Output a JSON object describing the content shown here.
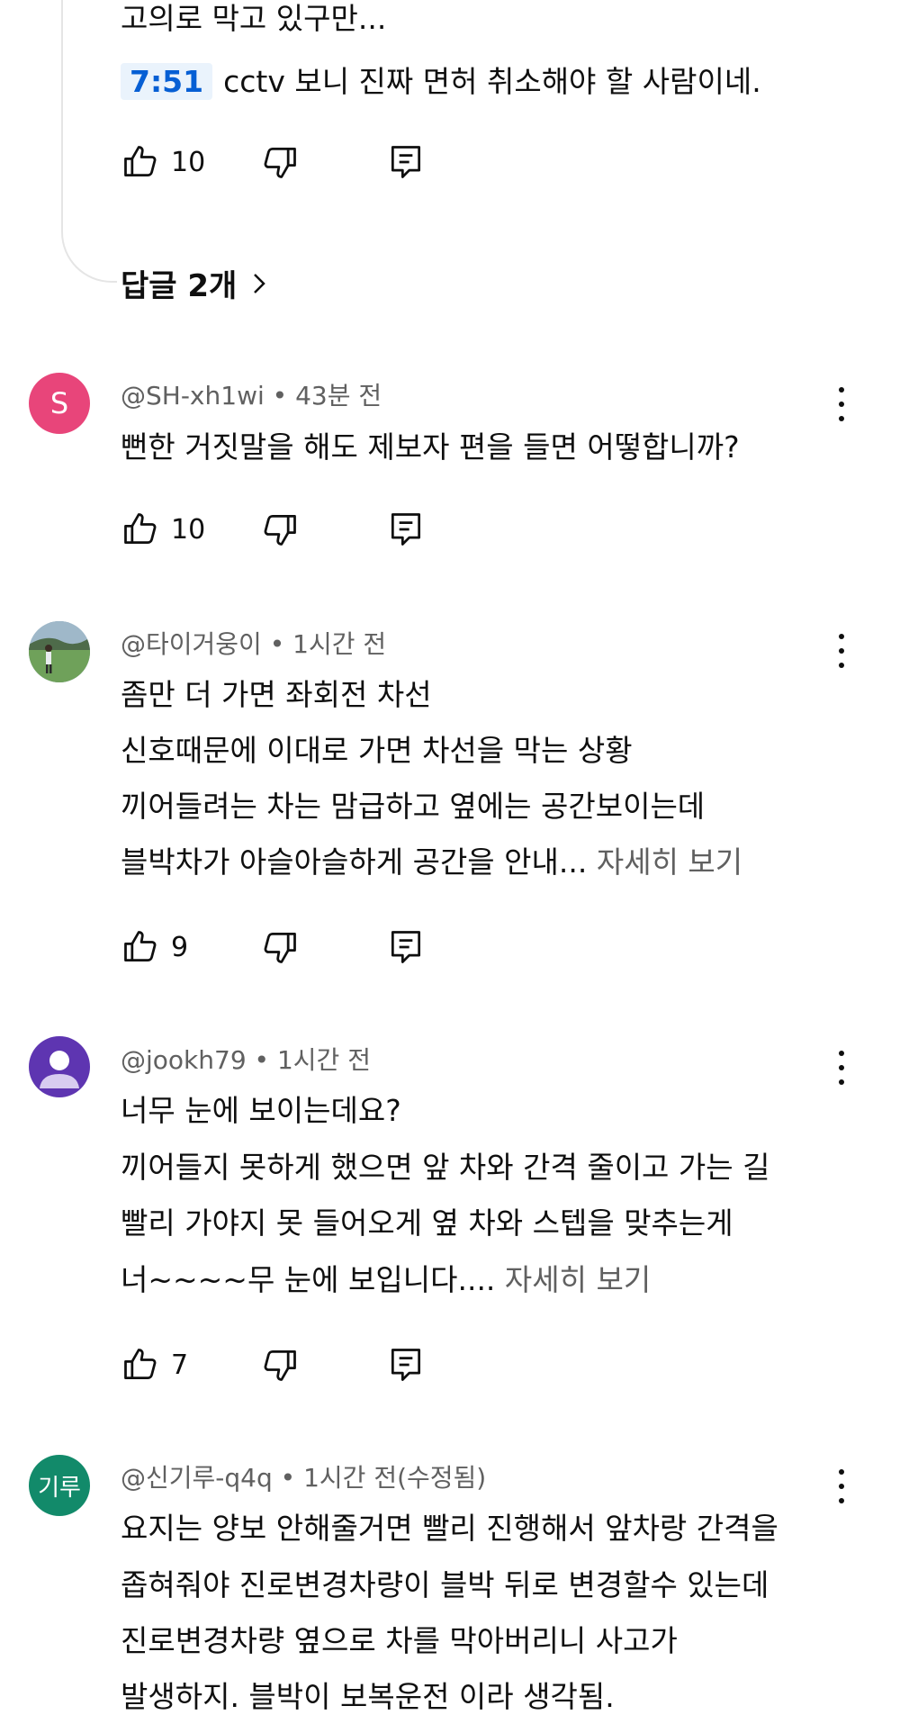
{
  "top_reply": {
    "text_line1": "고의로 막고 있구만...",
    "timestamp": "7:51",
    "text_line2": "cctv 보니 진짜 면허 취소해야 할 사람이네.",
    "likes": "10"
  },
  "replies_link": "답글 2개",
  "comments": [
    {
      "author": "@SH-xh1wi",
      "time": "43분 전",
      "avatar_letter": "S",
      "avatar_color": "#e8457a",
      "lines": [
        "뻔한 거짓말을 해도 제보자 편을 들면 어떻합니까?"
      ],
      "likes": "10"
    },
    {
      "author": "@타이거웅이",
      "time": "1시간 전",
      "avatar_icon": "golfer-photo",
      "lines": [
        "좀만 더 가면 좌회전 차선",
        "신호때문에 이대로 가면 차선을 막는 상황",
        "끼어들려는 차는 맘급하고 옆에는 공간보이는데",
        "블박차가 아슬아슬하게 공간을 안내..."
      ],
      "more": "자세히 보기",
      "likes": "9"
    },
    {
      "author": "@jookh79",
      "time": "1시간 전",
      "avatar_icon": "default-person-icon",
      "avatar_color": "#5e35b1",
      "lines": [
        "너무 눈에 보이는데요?",
        "끼어들지 못하게 했으면 앞 차와 간격 줄이고 가는 길",
        "빨리 가야지 못 들어오게 옆 차와 스텝을 맞추는게",
        "너~~~~무 눈에 보입니다...."
      ],
      "more": "자세히 보기",
      "likes": "7"
    },
    {
      "author": "@신기루-q4q",
      "time": "1시간 전(수정됨)",
      "avatar_letter": "기루",
      "avatar_color": "#128a6a",
      "lines": [
        "요지는 양보 안해줄거면 빨리 진행해서 앞차랑 간격을",
        "좁혀줘야 진로변경차량이 블박 뒤로 변경할수 있는데",
        "진로변경차량 옆으로 차를 막아버리니 사고가",
        "발생하지.  블박이 보복운전 이라 생각됨."
      ]
    }
  ],
  "meta_separator": "•"
}
